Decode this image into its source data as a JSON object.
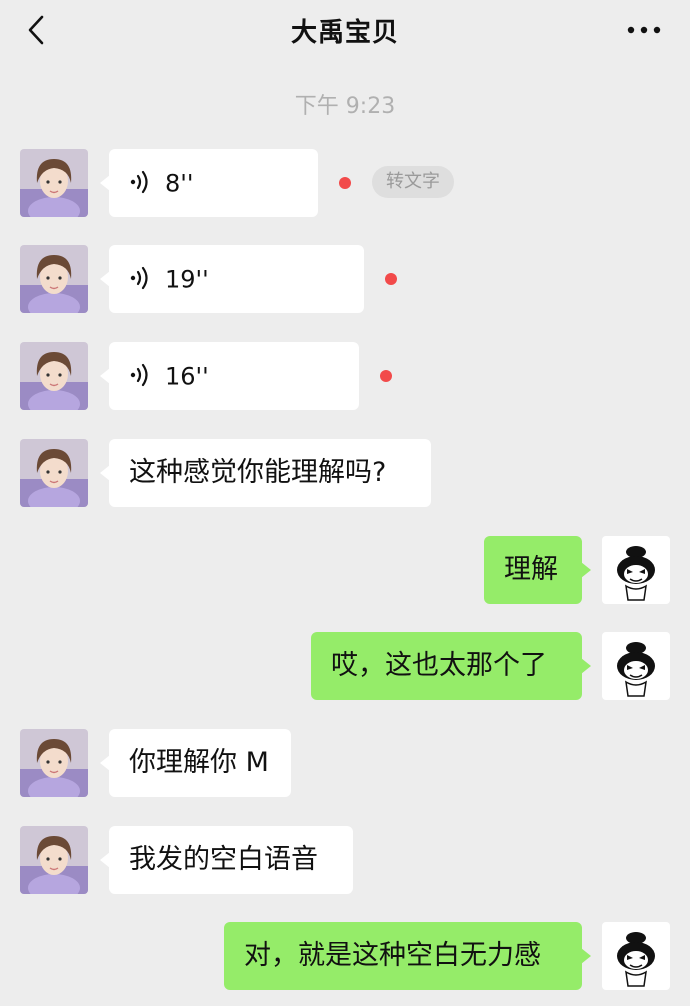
{
  "header": {
    "title": "大禹宝贝",
    "back_icon": "chevron-left-icon",
    "more_icon": "more-dots-icon"
  },
  "timestamp": "下午 9:23",
  "transcribe_label": "转文字",
  "colors": {
    "background": "#ededed",
    "incoming_bubble": "#ffffff",
    "outgoing_bubble": "#95ec69",
    "unread_dot": "#f24a4a"
  },
  "messages": [
    {
      "direction": "in",
      "type": "voice",
      "duration": "8''",
      "unread": true
    },
    {
      "direction": "in",
      "type": "voice",
      "duration": "19''",
      "unread": true
    },
    {
      "direction": "in",
      "type": "voice",
      "duration": "16''",
      "unread": true
    },
    {
      "direction": "in",
      "type": "text",
      "text": "这种感觉你能理解吗?"
    },
    {
      "direction": "out",
      "type": "text",
      "text": "理解"
    },
    {
      "direction": "out",
      "type": "text",
      "text": "哎，这也太那个了"
    },
    {
      "direction": "in",
      "type": "text",
      "text": "你理解你 M"
    },
    {
      "direction": "in",
      "type": "text",
      "text": "我发的空白语音"
    },
    {
      "direction": "out",
      "type": "text",
      "text": "对，就是这种空白无力感"
    }
  ]
}
